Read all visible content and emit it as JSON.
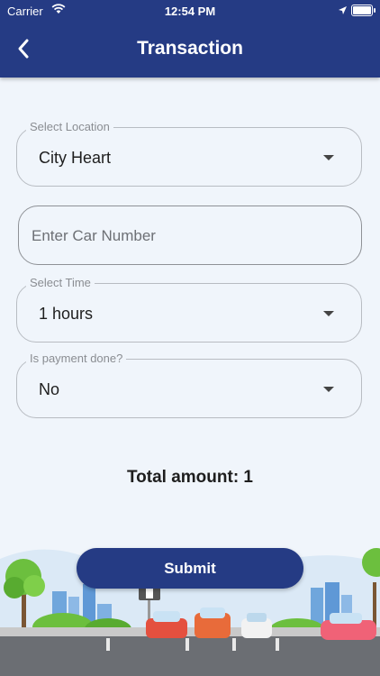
{
  "status_bar": {
    "carrier": "Carrier",
    "time": "12:54 PM"
  },
  "header": {
    "title": "Transaction",
    "back_icon": "chevron-left-icon"
  },
  "form": {
    "location": {
      "label": "Select Location",
      "value": "City Heart"
    },
    "car_number": {
      "placeholder": "Enter Car Number",
      "value": ""
    },
    "time": {
      "label": "Select Time",
      "value": "1 hours"
    },
    "payment": {
      "label": "Is payment done?",
      "value": "No"
    }
  },
  "total": {
    "text": "Total amount: 1"
  },
  "submit_label": "Submit",
  "colors": {
    "header": "#253b84",
    "background": "#f0f5fb",
    "button": "#253b84"
  }
}
